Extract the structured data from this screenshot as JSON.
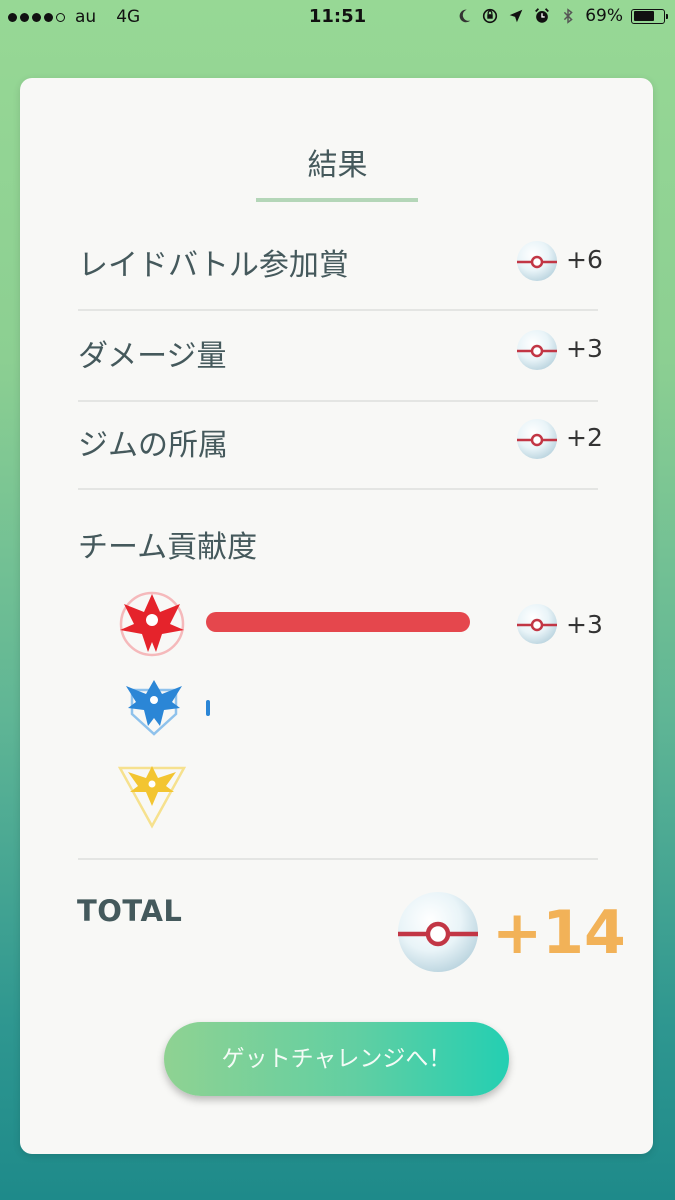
{
  "status_bar": {
    "carrier": "au",
    "network": "4G",
    "time": "11:51",
    "battery": "69%",
    "battery_level": 0.69
  },
  "results": {
    "title": "結果",
    "rows": [
      {
        "label": "レイドバトル参加賞",
        "value": "+6"
      },
      {
        "label": "ダメージ量",
        "value": "+3"
      },
      {
        "label": "ジムの所属",
        "value": "+2"
      }
    ],
    "team_section": {
      "label": "チーム貢献度",
      "value": "+3",
      "teams": [
        {
          "icon": "team-valor-icon",
          "color": "#e5474d",
          "contribution": 1.0
        },
        {
          "icon": "team-mystic-icon",
          "color": "#2b86d6",
          "contribution": 0.0
        },
        {
          "icon": "team-instinct-icon",
          "color": "#f3c531",
          "contribution": 0.0
        }
      ]
    },
    "total_label": "TOTAL",
    "total_value": "+14",
    "button_label": "ゲットチャレンジへ！"
  },
  "colors": {
    "accent_orange": "#f2b258",
    "text_dark": "#45595c"
  }
}
